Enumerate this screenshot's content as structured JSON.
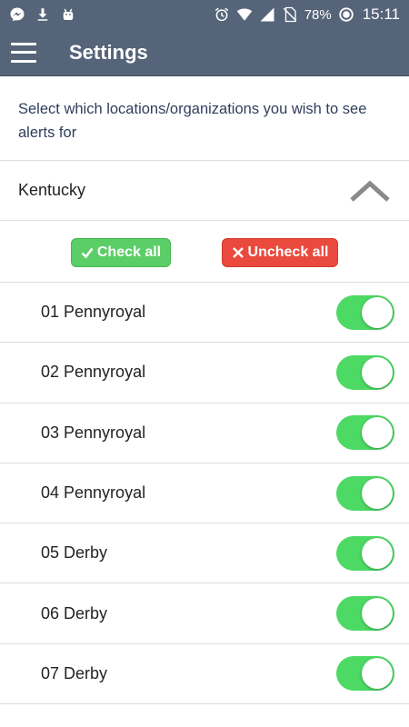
{
  "status_bar": {
    "icons_left": [
      "messenger-icon",
      "download-icon",
      "android-icon"
    ],
    "icons_right": [
      "alarm-icon",
      "wifi-icon",
      "signal-icon",
      "no-sim-icon"
    ],
    "battery": "78%",
    "time": "15:11"
  },
  "app_bar": {
    "menu_icon": "menu-icon",
    "title": "Settings"
  },
  "intro_text": "Select which locations/organizations you wish to see alerts for",
  "region": {
    "name": "Kentucky",
    "expanded": true
  },
  "actions": {
    "check_all": "Check all",
    "uncheck_all": "Uncheck all",
    "check_color": "#5cce67",
    "uncheck_color": "#ea4a3d"
  },
  "toggle_on_color": "#4cd964",
  "locations": [
    {
      "label": "01 Pennyroyal",
      "enabled": true
    },
    {
      "label": "02 Pennyroyal",
      "enabled": true
    },
    {
      "label": "03 Pennyroyal",
      "enabled": true
    },
    {
      "label": "04 Pennyroyal",
      "enabled": true
    },
    {
      "label": "05 Derby",
      "enabled": true
    },
    {
      "label": "06 Derby",
      "enabled": true
    },
    {
      "label": "07 Derby",
      "enabled": true
    }
  ]
}
